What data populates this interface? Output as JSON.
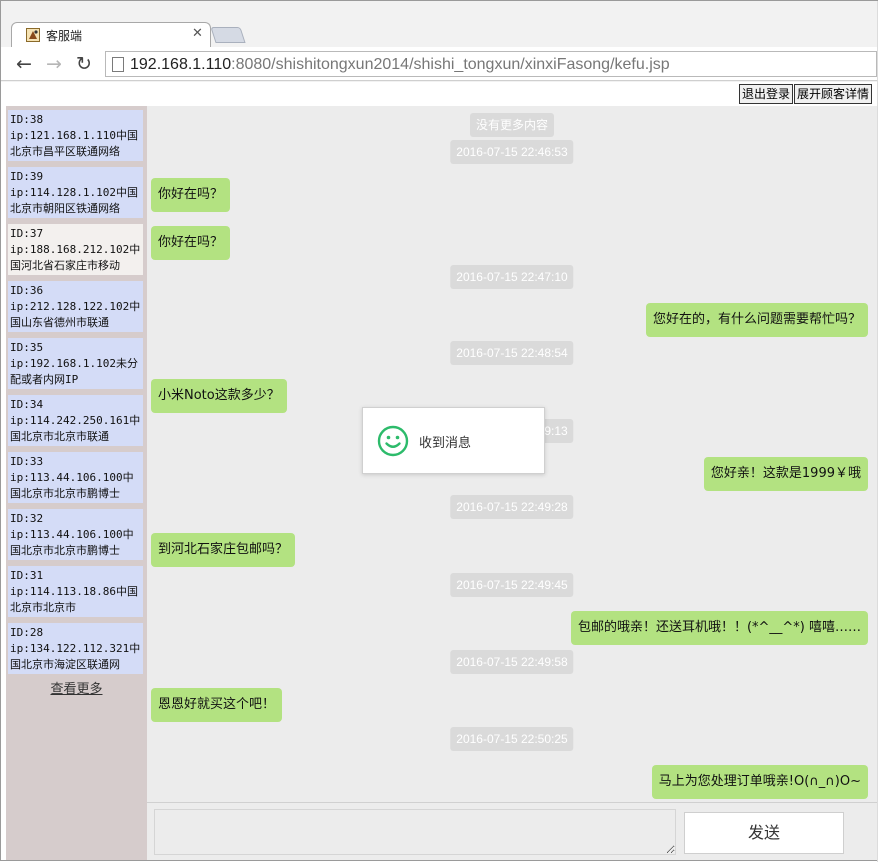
{
  "browser": {
    "tab_title": "客服端",
    "url_host": "192.168.1.110",
    "url_rest": ":8080/shishitongxun2014/shishi_tongxun/xinxiFasong/kefu.jsp"
  },
  "header": {
    "logout_label": "退出登录",
    "details_label": "展开顾客详情"
  },
  "sidebar": {
    "users": [
      {
        "id": "ID:38",
        "ip": "ip:121.168.1.110中国北京市昌平区联通网络"
      },
      {
        "id": "ID:39",
        "ip": "ip:114.128.1.102中国北京市朝阳区铁通网络"
      },
      {
        "id": "ID:37",
        "ip": "ip:188.168.212.102中国河北省石家庄市移动"
      },
      {
        "id": "ID:36",
        "ip": "ip:212.128.122.102中国山东省德州市联通"
      },
      {
        "id": "ID:35",
        "ip": "ip:192.168.1.102未分配或者内网IP"
      },
      {
        "id": "ID:34",
        "ip": "ip:114.242.250.161中国北京市北京市联通"
      },
      {
        "id": "ID:33",
        "ip": "ip:113.44.106.100中国北京市北京市鹏博士"
      },
      {
        "id": "ID:32",
        "ip": "ip:113.44.106.100中国北京市北京市鹏博士"
      },
      {
        "id": "ID:31",
        "ip": "ip:114.113.18.86中国北京市北京市"
      },
      {
        "id": "ID:28",
        "ip": "ip:134.122.112.321中国北京市海淀区联通网"
      }
    ],
    "more_label": "查看更多"
  },
  "chat": {
    "no_more": "没有更多内容",
    "messages": [
      {
        "type": "time",
        "text": "2016-07-15 22:46:53"
      },
      {
        "type": "left",
        "text": "你好在吗？"
      },
      {
        "type": "left",
        "text": "你好在吗？"
      },
      {
        "type": "time",
        "text": "2016-07-15 22:47:10"
      },
      {
        "type": "right",
        "text": "您好在的，有什么问题需要帮忙吗？"
      },
      {
        "type": "time",
        "text": "2016-07-15 22:48:54"
      },
      {
        "type": "left",
        "text": "小米Noto这款多少？"
      },
      {
        "type": "time",
        "text": "2016-07-15 22:49:13"
      },
      {
        "type": "right",
        "text": "您好亲！这款是1999￥哦"
      },
      {
        "type": "time",
        "text": "2016-07-15 22:49:28"
      },
      {
        "type": "left",
        "text": "到河北石家庄包邮吗？"
      },
      {
        "type": "time",
        "text": "2016-07-15 22:49:45"
      },
      {
        "type": "right",
        "text": "包邮的哦亲！还送耳机哦！！(*^__^*) 嘻嘻……"
      },
      {
        "type": "time",
        "text": "2016-07-15 22:49:58"
      },
      {
        "type": "left",
        "text": "恩恩好就买这个吧！"
      },
      {
        "type": "time",
        "text": "2016-07-15 22:50:25"
      },
      {
        "type": "right",
        "text": "马上为您处理订单哦亲!O(∩_∩)O~"
      }
    ]
  },
  "composer": {
    "send_label": "发送"
  },
  "toast": {
    "text": "收到消息",
    "icon": "smile-icon",
    "color": "#2dbb6b"
  },
  "colors": {
    "bubble": "#b3e281",
    "sidebar_item": "#d4dcf7",
    "chat_bg": "#ececec"
  }
}
